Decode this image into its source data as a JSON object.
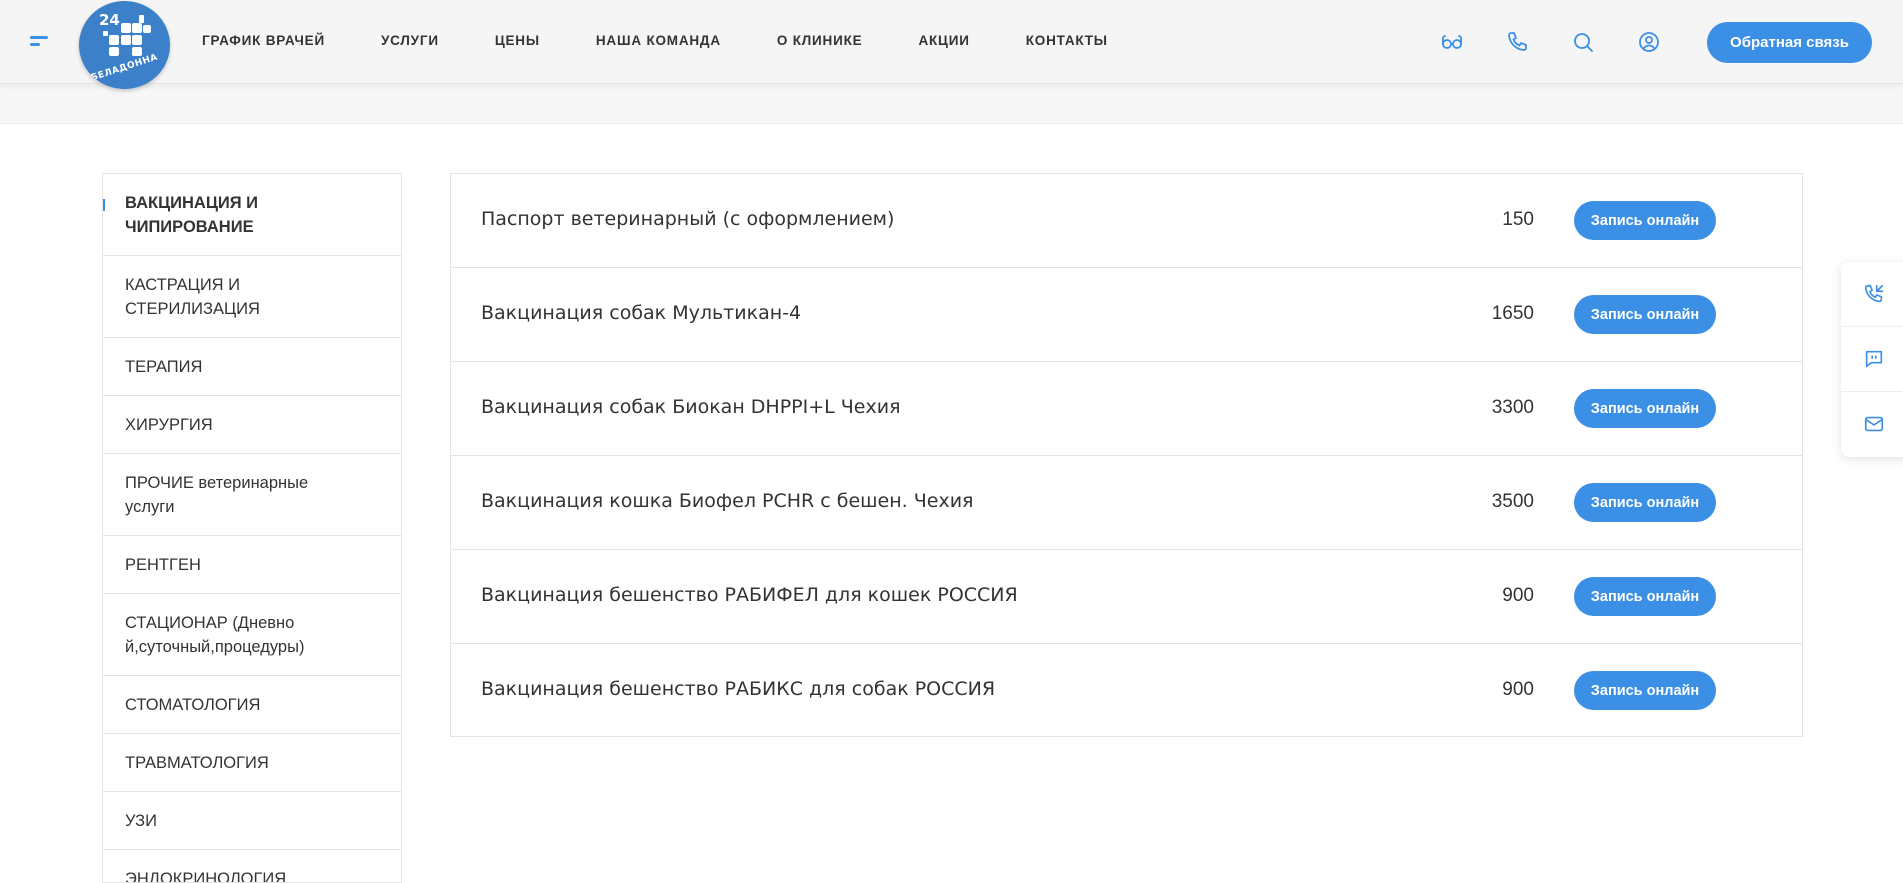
{
  "header": {
    "logo": {
      "number": "24",
      "name": "БЕЛАДОННА"
    },
    "nav": [
      {
        "label": "ГРАФИК ВРАЧЕЙ",
        "name": "nav-schedule"
      },
      {
        "label": "УСЛУГИ",
        "name": "nav-services"
      },
      {
        "label": "ЦЕНЫ",
        "name": "nav-prices"
      },
      {
        "label": "НАША КОМАНДА",
        "name": "nav-team"
      },
      {
        "label": "О КЛИНИКЕ",
        "name": "nav-about"
      },
      {
        "label": "АКЦИИ",
        "name": "nav-promotions"
      },
      {
        "label": "КОНТАКТЫ",
        "name": "nav-contacts"
      }
    ],
    "icons": [
      "glasses-icon",
      "phone-icon",
      "search-icon",
      "user-icon"
    ],
    "cta_label": "Обратная связь"
  },
  "sidebar": {
    "items": [
      {
        "label": "ВАКЦИНАЦИЯ И ЧИПИРОВАНИЕ",
        "active": true
      },
      {
        "label": "КАСТРАЦИЯ И СТЕРИЛИЗАЦИЯ",
        "active": false
      },
      {
        "label": "ТЕРАПИЯ",
        "active": false
      },
      {
        "label": "ХИРУРГИЯ",
        "active": false
      },
      {
        "label": "ПРОЧИЕ ветеринарные услуги",
        "active": false
      },
      {
        "label": "РЕНТГЕН",
        "active": false
      },
      {
        "label": "СТАЦИОНАР (Дневной,суточный,процедуры)",
        "active": false
      },
      {
        "label": "СТОМАТОЛОГИЯ",
        "active": false
      },
      {
        "label": "ТРАВМАТОЛОГИЯ",
        "active": false
      },
      {
        "label": "УЗИ",
        "active": false
      },
      {
        "label": "ЭНДОКРИНОЛОГИЯ",
        "active": false
      }
    ]
  },
  "prices": {
    "button_label": "Запись онлайн",
    "rows": [
      {
        "service": "Паспорт ветеринарный (с оформлением)",
        "price": "150"
      },
      {
        "service": "Вакцинация собак Мультикан-4",
        "price": "1650"
      },
      {
        "service": "Вакцинация собак Биокан DHPPI+L Чехия",
        "price": "3300"
      },
      {
        "service": "Вакцинация кошка Биофел PCHR с бешен. Чехия",
        "price": "3500"
      },
      {
        "service": "Вакцинация бешенство РАБИФЕЛ для кошек РОССИЯ",
        "price": "900"
      },
      {
        "service": "Вакцинация бешенство РАБИКС для собак РОССИЯ",
        "price": "900"
      }
    ]
  },
  "floating": {
    "icons": [
      "callback-icon",
      "chat-icon",
      "mail-icon"
    ]
  },
  "colors": {
    "accent": "#3b8fe5",
    "logo": "#3b80c8"
  }
}
